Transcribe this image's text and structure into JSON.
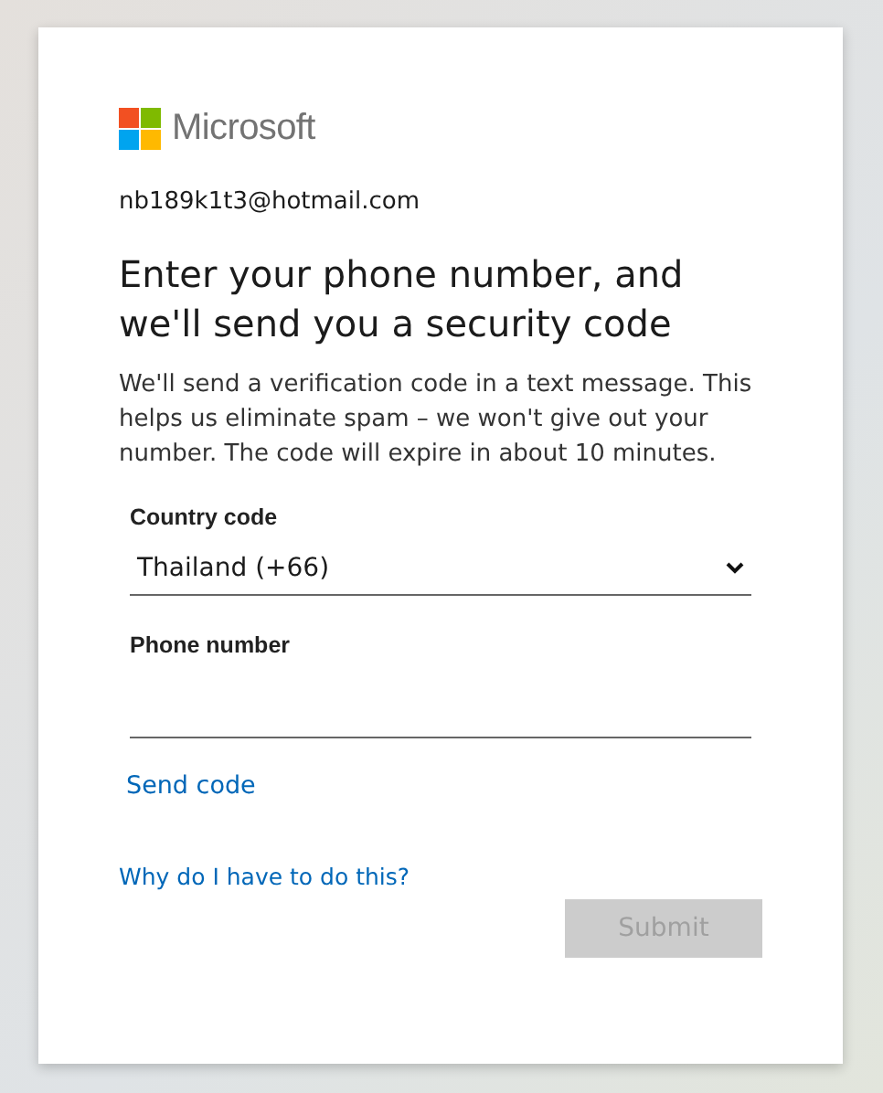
{
  "logo": {
    "text": "Microsoft"
  },
  "account": "nb189k1t3@hotmail.com",
  "heading": "Enter your phone number, and we'll send you a security code",
  "description": "We'll send a verification code in a text message. This helps us eliminate spam – we won't give out your number. The code will expire in about 10 minutes.",
  "country_code": {
    "label": "Country code",
    "value": "Thailand (+66)"
  },
  "phone_number": {
    "label": "Phone number"
  },
  "send_code_link": "Send code",
  "help_link": "Why do I have to do this?",
  "submit_button": {
    "label": "Submit",
    "disabled": true
  }
}
